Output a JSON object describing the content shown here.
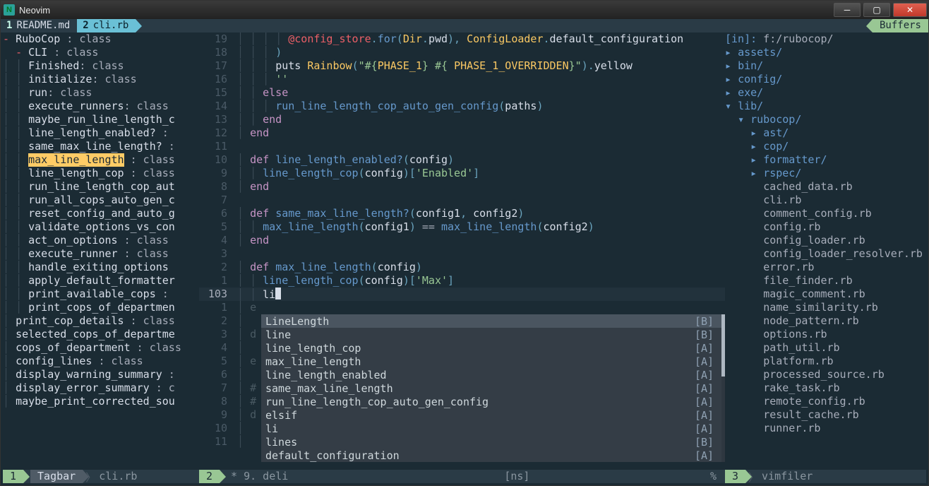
{
  "window": {
    "title": "Neovim"
  },
  "tabs": {
    "items": [
      {
        "num": "1",
        "label": "README.md",
        "active": false
      },
      {
        "num": "2",
        "label": "cli.rb",
        "active": true
      }
    ],
    "right_label": "Buffers"
  },
  "tagbar": {
    "root": {
      "marker": "-",
      "name": "RuboCop",
      "type": ": class"
    },
    "cli": {
      "marker": "-",
      "name": "CLI",
      "type": ": class"
    },
    "items": [
      {
        "name": "Finished",
        "type": ": class"
      },
      {
        "name": "initialize",
        "type": ": class"
      },
      {
        "name": "run",
        "type": ": class"
      },
      {
        "name": "execute_runners",
        "type": ": class"
      },
      {
        "name": "maybe_run_line_length_c",
        "type": ""
      },
      {
        "name": "line_length_enabled?",
        "type": " :"
      },
      {
        "name": "same_max_line_length?",
        "type": " :"
      },
      {
        "name": "max_line_length",
        "type": " : class",
        "hl": true
      },
      {
        "name": "line_length_cop",
        "type": " : class"
      },
      {
        "name": "run_line_length_cop_aut",
        "type": ""
      },
      {
        "name": "run_all_cops_auto_gen_c",
        "type": ""
      },
      {
        "name": "reset_config_and_auto_g",
        "type": ""
      },
      {
        "name": "validate_options_vs_con",
        "type": ""
      },
      {
        "name": "act_on_options",
        "type": " : class"
      },
      {
        "name": "execute_runner",
        "type": " : class"
      },
      {
        "name": "handle_exiting_options",
        "type": ""
      },
      {
        "name": "apply_default_formatter",
        "type": ""
      },
      {
        "name": "print_available_cops",
        "type": " :"
      },
      {
        "name": "print_cops_of_departmen",
        "type": ""
      }
    ],
    "flat": [
      {
        "name": "print_cop_details",
        "type": " : class"
      },
      {
        "name": "selected_cops_of_departme",
        "type": ""
      },
      {
        "name": "cops_of_department",
        "type": " : class"
      },
      {
        "name": "config_lines",
        "type": " : class"
      },
      {
        "name": "display_warning_summary",
        "type": " :"
      },
      {
        "name": "display_error_summary",
        "type": " : c"
      },
      {
        "name": "maybe_print_corrected_sou",
        "type": ""
      }
    ]
  },
  "editor": {
    "lines": [
      {
        "n": "19",
        "indent": "        ",
        "t": [
          [
            "ivar",
            "@config_store"
          ],
          [
            "punct",
            "."
          ],
          [
            "call",
            "for"
          ],
          [
            "punct",
            "("
          ],
          [
            "const",
            "Dir"
          ],
          [
            "punct",
            "."
          ],
          [
            "ident",
            "pwd"
          ],
          [
            "punct",
            "), "
          ],
          [
            "const",
            "ConfigLoader"
          ],
          [
            "punct",
            "."
          ],
          [
            "ident",
            "default_configuration"
          ]
        ]
      },
      {
        "n": "18",
        "indent": "      ",
        "t": [
          [
            "punct",
            ")"
          ]
        ]
      },
      {
        "n": "17",
        "indent": "      ",
        "t": [
          [
            "ident",
            "puts "
          ],
          [
            "const",
            "Rainbow"
          ],
          [
            "punct",
            "("
          ],
          [
            "str",
            "\"#{"
          ],
          [
            "const",
            "PHASE_1"
          ],
          [
            "str",
            "} #{ "
          ],
          [
            "const",
            "PHASE_1_OVERRIDDEN"
          ],
          [
            "str",
            "}\""
          ],
          [
            "punct",
            ")."
          ],
          [
            "ident",
            "yellow"
          ]
        ]
      },
      {
        "n": "16",
        "indent": "      ",
        "t": [
          [
            "str",
            "''"
          ]
        ]
      },
      {
        "n": "15",
        "indent": "    ",
        "t": [
          [
            "kw-def",
            "else"
          ]
        ]
      },
      {
        "n": "14",
        "indent": "      ",
        "t": [
          [
            "call",
            "run_line_length_cop_auto_gen_config"
          ],
          [
            "punct",
            "("
          ],
          [
            "ident",
            "paths"
          ],
          [
            "punct",
            ")"
          ]
        ]
      },
      {
        "n": "13",
        "indent": "    ",
        "t": [
          [
            "kw-end",
            "end"
          ]
        ]
      },
      {
        "n": "12",
        "indent": "  ",
        "t": [
          [
            "kw-end",
            "end"
          ]
        ]
      },
      {
        "n": "11",
        "indent": "",
        "t": []
      },
      {
        "n": "10",
        "indent": "  ",
        "t": [
          [
            "kw-def",
            "def "
          ],
          [
            "fn",
            "line_length_enabled?"
          ],
          [
            "punct",
            "("
          ],
          [
            "ident",
            "config"
          ],
          [
            "punct",
            ")"
          ]
        ]
      },
      {
        "n": "9",
        "indent": "    ",
        "t": [
          [
            "call",
            "line_length_cop"
          ],
          [
            "punct",
            "("
          ],
          [
            "ident",
            "config"
          ],
          [
            "punct",
            ")["
          ],
          [
            "str",
            "'Enabled'"
          ],
          [
            "punct",
            "]"
          ]
        ]
      },
      {
        "n": "8",
        "indent": "  ",
        "t": [
          [
            "kw-end",
            "end"
          ]
        ]
      },
      {
        "n": "7",
        "indent": "",
        "t": []
      },
      {
        "n": "6",
        "indent": "  ",
        "t": [
          [
            "kw-def",
            "def "
          ],
          [
            "fn",
            "same_max_line_length?"
          ],
          [
            "punct",
            "("
          ],
          [
            "ident",
            "config1"
          ],
          [
            "punct",
            ", "
          ],
          [
            "ident",
            "config2"
          ],
          [
            "punct",
            ")"
          ]
        ]
      },
      {
        "n": "5",
        "indent": "    ",
        "t": [
          [
            "call",
            "max_line_length"
          ],
          [
            "punct",
            "("
          ],
          [
            "ident",
            "config1"
          ],
          [
            "punct",
            ") "
          ],
          [
            "op",
            "=="
          ],
          [
            "punct",
            " "
          ],
          [
            "call",
            "max_line_length"
          ],
          [
            "punct",
            "("
          ],
          [
            "ident",
            "config2"
          ],
          [
            "punct",
            ")"
          ]
        ]
      },
      {
        "n": "4",
        "indent": "  ",
        "t": [
          [
            "kw-end",
            "end"
          ]
        ]
      },
      {
        "n": "3",
        "indent": "",
        "t": []
      },
      {
        "n": "2",
        "indent": "  ",
        "t": [
          [
            "kw-def",
            "def "
          ],
          [
            "fn",
            "max_line_length"
          ],
          [
            "punct",
            "("
          ],
          [
            "ident",
            "config"
          ],
          [
            "punct",
            ")"
          ]
        ]
      },
      {
        "n": "1",
        "indent": "    ",
        "t": [
          [
            "call",
            "line_length_cop"
          ],
          [
            "punct",
            "("
          ],
          [
            "ident",
            "config"
          ],
          [
            "punct",
            ")["
          ],
          [
            "str",
            "'Max'"
          ],
          [
            "punct",
            "]"
          ]
        ]
      },
      {
        "n": "103",
        "indent": "    ",
        "cur": true,
        "t": [
          [
            "txt",
            "li"
          ]
        ]
      }
    ],
    "dim_lines": [
      {
        "n": "1",
        "pre": "e"
      },
      {
        "n": "2",
        "pre": " "
      },
      {
        "n": "3",
        "pre": "d"
      },
      {
        "n": "4",
        "pre": " "
      },
      {
        "n": "5",
        "pre": "e"
      },
      {
        "n": "6",
        "pre": " "
      },
      {
        "n": "7",
        "pre": "#",
        "tail": "                                       d"
      },
      {
        "n": "8",
        "pre": "#"
      },
      {
        "n": "9",
        "pre": "d"
      },
      {
        "n": "10",
        "pre": " "
      },
      {
        "n": "11",
        "pre": " "
      }
    ],
    "popup": {
      "items": [
        {
          "label": "LineLength",
          "kind": "[B]"
        },
        {
          "label": "line",
          "kind": "[B]"
        },
        {
          "label": "line_length_cop",
          "kind": "[A]"
        },
        {
          "label": "max_line_length",
          "kind": "[A]"
        },
        {
          "label": "line_length_enabled",
          "kind": "[A]"
        },
        {
          "label": "same_max_line_length",
          "kind": "[A]"
        },
        {
          "label": "run_line_length_cop_auto_gen_config",
          "kind": "[A]"
        },
        {
          "label": "elsif",
          "kind": "[A]"
        },
        {
          "label": "li",
          "kind": "[A]"
        },
        {
          "label": "lines",
          "kind": "[B]"
        },
        {
          "label": "default_configuration",
          "kind": "[A]"
        }
      ]
    }
  },
  "tree": {
    "header_left": "[in]:",
    "header_right": " f:/rubocop/",
    "nodes": [
      {
        "depth": 0,
        "marker": "▸",
        "name": "assets/",
        "dir": true
      },
      {
        "depth": 0,
        "marker": "▸",
        "name": "bin/",
        "dir": true
      },
      {
        "depth": 0,
        "marker": "▸",
        "name": "config/",
        "dir": true
      },
      {
        "depth": 0,
        "marker": "▸",
        "name": "exe/",
        "dir": true
      },
      {
        "depth": 0,
        "marker": "▾",
        "name": "lib/",
        "dir": true
      },
      {
        "depth": 1,
        "marker": "▾",
        "name": "rubocop/",
        "dir": true
      },
      {
        "depth": 2,
        "marker": "▸",
        "name": "ast/",
        "dir": true
      },
      {
        "depth": 2,
        "marker": "▸",
        "name": "cop/",
        "dir": true
      },
      {
        "depth": 2,
        "marker": "▸",
        "name": "formatter/",
        "dir": true
      },
      {
        "depth": 2,
        "marker": "▸",
        "name": "rspec/",
        "dir": true
      },
      {
        "depth": 2,
        "marker": " ",
        "name": "cached_data.rb"
      },
      {
        "depth": 2,
        "marker": " ",
        "name": "cli.rb"
      },
      {
        "depth": 2,
        "marker": " ",
        "name": "comment_config.rb"
      },
      {
        "depth": 2,
        "marker": " ",
        "name": "config.rb"
      },
      {
        "depth": 2,
        "marker": " ",
        "name": "config_loader.rb"
      },
      {
        "depth": 2,
        "marker": " ",
        "name": "config_loader_resolver.rb"
      },
      {
        "depth": 2,
        "marker": " ",
        "name": "error.rb"
      },
      {
        "depth": 2,
        "marker": " ",
        "name": "file_finder.rb"
      },
      {
        "depth": 2,
        "marker": " ",
        "name": "magic_comment.rb"
      },
      {
        "depth": 2,
        "marker": " ",
        "name": "name_similarity.rb"
      },
      {
        "depth": 2,
        "marker": " ",
        "name": "node_pattern.rb"
      },
      {
        "depth": 2,
        "marker": " ",
        "name": "options.rb"
      },
      {
        "depth": 2,
        "marker": " ",
        "name": "path_util.rb"
      },
      {
        "depth": 2,
        "marker": " ",
        "name": "platform.rb"
      },
      {
        "depth": 2,
        "marker": " ",
        "name": "processed_source.rb"
      },
      {
        "depth": 2,
        "marker": " ",
        "name": "rake_task.rb"
      },
      {
        "depth": 2,
        "marker": " ",
        "name": "remote_config.rb"
      },
      {
        "depth": 2,
        "marker": " ",
        "name": "result_cache.rb"
      },
      {
        "depth": 2,
        "marker": " ",
        "name": "runner.rb"
      }
    ]
  },
  "status": {
    "left": {
      "num": "1",
      "mode": "Tagbar",
      "file": "cli.rb"
    },
    "mid": {
      "num": "2",
      "text": "* 9. deli",
      "right": "[ns]",
      "pct": "%"
    },
    "right": {
      "num": "3",
      "name": "vimfiler"
    }
  }
}
